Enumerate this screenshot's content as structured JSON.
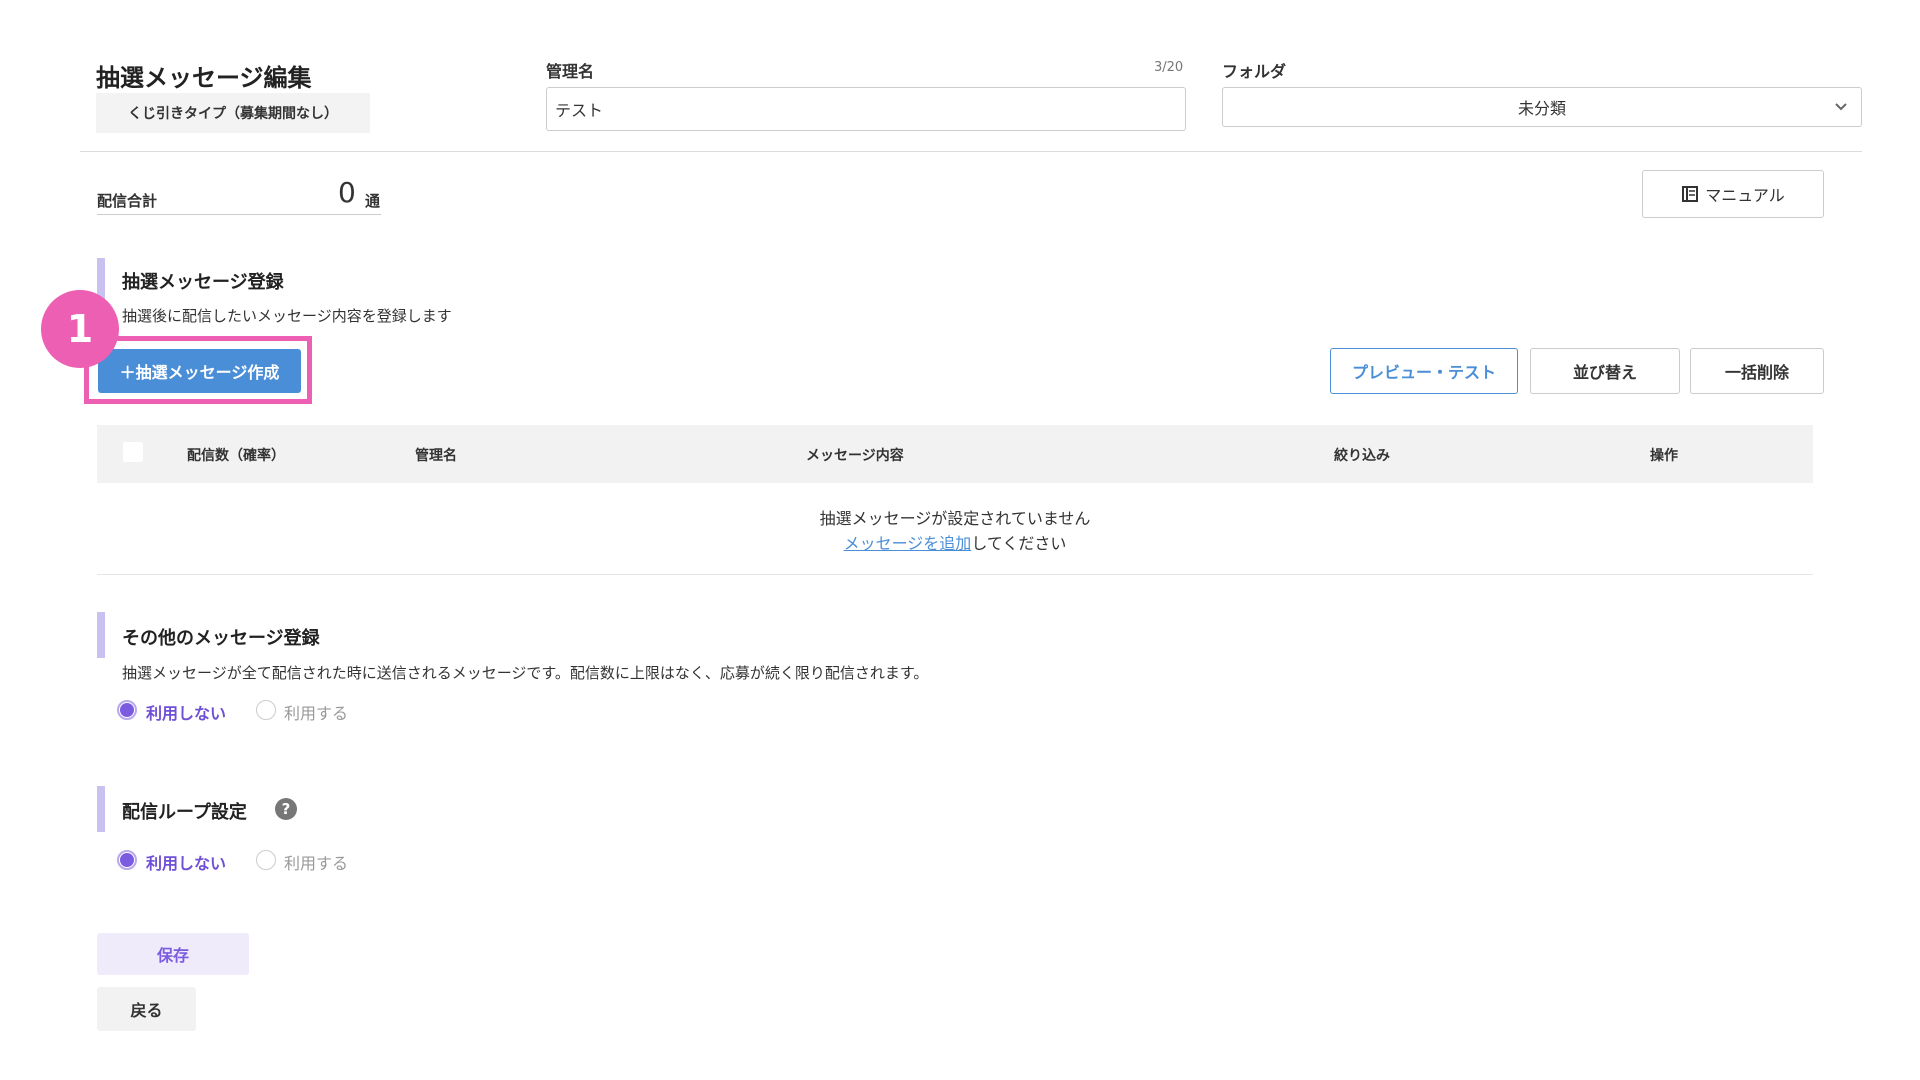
{
  "header": {
    "title": "抽選メッセージ編集",
    "type_badge": "くじ引きタイプ（募集期間なし）",
    "name_label": "管理名",
    "name_counter": "3/20",
    "name_value": "テスト",
    "folder_label": "フォルダ",
    "folder_value": "未分類"
  },
  "summary": {
    "label": "配信合計",
    "value": "0",
    "unit": "通",
    "manual_button": "マニュアル"
  },
  "lottery_section": {
    "title": "抽選メッセージ登録",
    "description": "抽選後に配信したいメッセージ内容を登録します",
    "step_number": "1",
    "create_button": "＋抽選メッセージ作成",
    "preview_button": "プレビュー・テスト",
    "sort_button": "並び替え",
    "bulk_delete_button": "一括削除",
    "table": {
      "columns": [
        "配信数（確率）",
        "管理名",
        "メッセージ内容",
        "絞り込み",
        "操作"
      ],
      "empty_message": "抽選メッセージが設定されていません",
      "empty_link": "メッセージを追加",
      "empty_suffix": "してください"
    }
  },
  "other_section": {
    "title": "その他のメッセージ登録",
    "description": "抽選メッセージが全て配信された時に送信されるメッセージです。配信数に上限はなく、応募が続く限り配信されます。",
    "options": [
      "利用しない",
      "利用する"
    ],
    "selected": "利用しない"
  },
  "loop_section": {
    "title": "配信ループ設定",
    "help_icon": "?",
    "options": [
      "利用しない",
      "利用する"
    ],
    "selected": "利用しない"
  },
  "footer": {
    "save_button": "保存",
    "back_button": "戻る"
  },
  "colors": {
    "accent_purple": "#7b5ce0",
    "section_bar": "#c9c2f0",
    "primary_blue": "#4a8ed8",
    "step_pink": "#ec5fb3"
  }
}
